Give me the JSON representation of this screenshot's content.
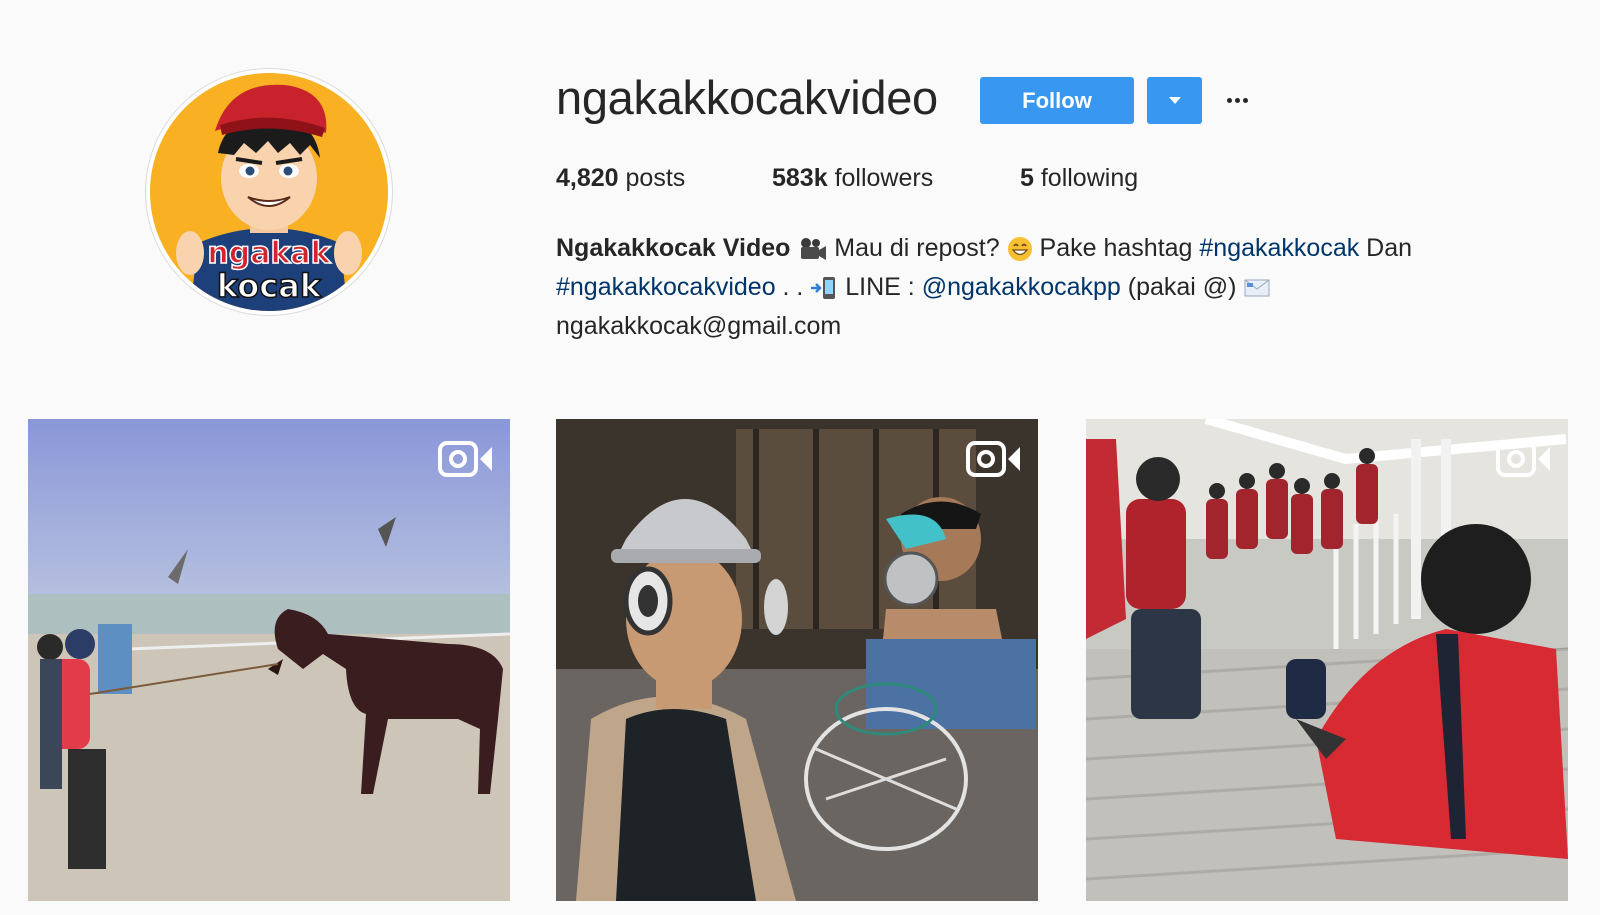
{
  "profile": {
    "username": "ngakakkocakvideo",
    "follow_label": "Follow",
    "avatar_text_top": "ngakak",
    "avatar_text_bottom": "kocak"
  },
  "stats": {
    "posts_count": "4,820",
    "posts_label": " posts",
    "followers_count": "583k",
    "followers_label": " followers",
    "following_count": "5",
    "following_label": " following"
  },
  "bio": {
    "name": "Ngakakkocak Video",
    "text1": " Mau di repost? ",
    "text2": " Pake hashtag ",
    "hashtag1": "#ngakakkocak",
    "text3": " Dan",
    "hashtag2": "#ngakakkocakvideo",
    "text4": " . . ",
    "text5": " LINE : ",
    "mention": "@ngakakkocakpp",
    "text6": " (pakai @) ",
    "email": "ngakakkocak@gmail.com"
  },
  "icons": {
    "movie_camera": "movie-camera-icon",
    "smile": "smile-emoji-icon",
    "phone": "mobile-phone-arrow-icon",
    "envelope": "envelope-icon",
    "video": "video-camera-icon",
    "more": "more-options-icon"
  },
  "colors": {
    "accent": "#3897f0",
    "link": "#003569",
    "background": "#fafafa",
    "text": "#262626"
  },
  "posts": [
    {
      "type": "video",
      "thumbnail": "horse-on-beach"
    },
    {
      "type": "video",
      "thumbnail": "men-with-pot-and-headphones"
    },
    {
      "type": "video",
      "thumbnail": "students-on-stairs"
    }
  ]
}
